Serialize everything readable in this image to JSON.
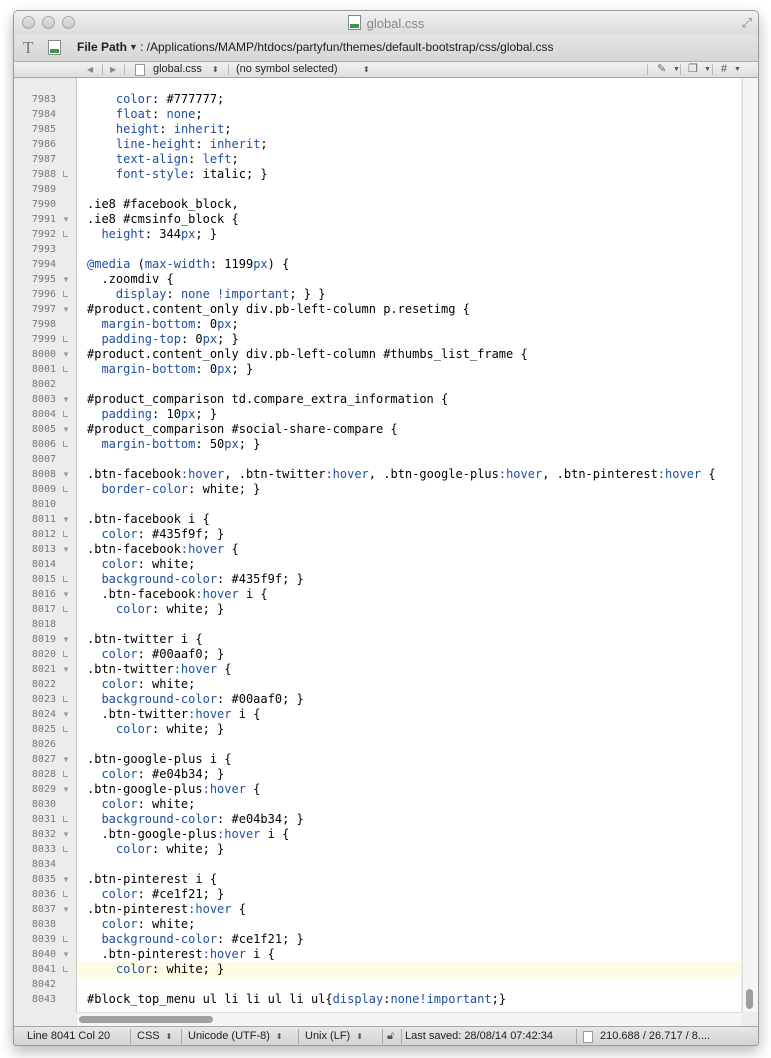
{
  "window": {
    "title": "global.css",
    "file_path_label": "File Path",
    "file_path": ": /Applications/MAMP/htdocs/partyfun/themes/default-bootstrap/css/global.css"
  },
  "navbar": {
    "back": "◀",
    "forward": "▶",
    "file_name": "global.css",
    "symbol": "(no symbol selected)",
    "hash": "#"
  },
  "code_lines": [
    {
      "n": "7983",
      "fold": "",
      "code": [
        [
          "    ",
          ""
        ],
        [
          "color",
          ".prop"
        ],
        [
          ": #777777;",
          ""
        ]
      ]
    },
    {
      "n": "7984",
      "fold": "",
      "code": [
        [
          "    ",
          ""
        ],
        [
          "float",
          ".prop"
        ],
        [
          ": ",
          ""
        ],
        [
          "none",
          "num"
        ],
        [
          ";",
          ""
        ]
      ]
    },
    {
      "n": "7985",
      "fold": "",
      "code": [
        [
          "    ",
          ""
        ],
        [
          "height",
          ".prop"
        ],
        [
          ": ",
          ""
        ],
        [
          "inherit",
          "num"
        ],
        [
          ";",
          ""
        ]
      ]
    },
    {
      "n": "7986",
      "fold": "",
      "code": [
        [
          "    ",
          ""
        ],
        [
          "line-height",
          ".prop"
        ],
        [
          ": ",
          ""
        ],
        [
          "inherit",
          "num"
        ],
        [
          ";",
          ""
        ]
      ]
    },
    {
      "n": "7987",
      "fold": "",
      "code": [
        [
          "    ",
          ""
        ],
        [
          "text-align",
          ".prop"
        ],
        [
          ": ",
          ""
        ],
        [
          "left",
          "num"
        ],
        [
          ";",
          ""
        ]
      ]
    },
    {
      "n": "7988",
      "fold": "end",
      "code": [
        [
          "    ",
          ""
        ],
        [
          "font-style",
          ".prop"
        ],
        [
          ": italic; }",
          ""
        ]
      ]
    },
    {
      "n": "7989",
      "fold": "",
      "code": []
    },
    {
      "n": "7990",
      "fold": "",
      "code": [
        [
          ".ie8 #facebook_block,",
          ""
        ]
      ]
    },
    {
      "n": "7991",
      "fold": "open",
      "code": [
        [
          ".ie8 #cmsinfo_block {",
          ""
        ]
      ]
    },
    {
      "n": "7992",
      "fold": "end",
      "code": [
        [
          "  ",
          ""
        ],
        [
          "height",
          ".prop"
        ],
        [
          ": 344",
          ""
        ],
        [
          "px",
          "num"
        ],
        [
          "; }",
          ""
        ]
      ]
    },
    {
      "n": "7993",
      "fold": "",
      "code": []
    },
    {
      "n": "7994",
      "fold": "",
      "code": [
        [
          "@media",
          "at"
        ],
        [
          " (",
          ""
        ],
        [
          "max-width",
          ".prop"
        ],
        [
          ": 1199",
          ""
        ],
        [
          "px",
          "num"
        ],
        [
          ") {",
          ""
        ]
      ]
    },
    {
      "n": "7995",
      "fold": "open",
      "code": [
        [
          "  .zoomdiv {",
          ""
        ]
      ]
    },
    {
      "n": "7996",
      "fold": "end",
      "code": [
        [
          "    ",
          ""
        ],
        [
          "display",
          ".prop"
        ],
        [
          ": ",
          ""
        ],
        [
          "none !important",
          "num"
        ],
        [
          "; } }",
          ""
        ]
      ]
    },
    {
      "n": "7997",
      "fold": "open",
      "code": [
        [
          "#product.content_only div.pb-left-column p.resetimg {",
          ""
        ]
      ]
    },
    {
      "n": "7998",
      "fold": "",
      "code": [
        [
          "  ",
          ""
        ],
        [
          "margin-bottom",
          ".prop"
        ],
        [
          ": 0",
          ""
        ],
        [
          "px",
          "num"
        ],
        [
          ";",
          ""
        ]
      ]
    },
    {
      "n": "7999",
      "fold": "end",
      "code": [
        [
          "  ",
          ""
        ],
        [
          "padding-top",
          ".prop"
        ],
        [
          ": 0",
          ""
        ],
        [
          "px",
          "num"
        ],
        [
          "; }",
          ""
        ]
      ]
    },
    {
      "n": "8000",
      "fold": "open",
      "code": [
        [
          "#product.content_only div.pb-left-column #thumbs_list_frame {",
          ""
        ]
      ]
    },
    {
      "n": "8001",
      "fold": "end",
      "code": [
        [
          "  ",
          ""
        ],
        [
          "margin-bottom",
          ".prop"
        ],
        [
          ": 0",
          ""
        ],
        [
          "px",
          "num"
        ],
        [
          "; }",
          ""
        ]
      ]
    },
    {
      "n": "8002",
      "fold": "",
      "code": []
    },
    {
      "n": "8003",
      "fold": "open",
      "code": [
        [
          "#product_comparison td.compare_extra_information {",
          ""
        ]
      ]
    },
    {
      "n": "8004",
      "fold": "end",
      "code": [
        [
          "  ",
          ""
        ],
        [
          "padding",
          ".prop"
        ],
        [
          ": 10",
          ""
        ],
        [
          "px",
          "num"
        ],
        [
          "; }",
          ""
        ]
      ]
    },
    {
      "n": "8005",
      "fold": "open",
      "code": [
        [
          "#product_comparison #social-share-compare {",
          ""
        ]
      ]
    },
    {
      "n": "8006",
      "fold": "end",
      "code": [
        [
          "  ",
          ""
        ],
        [
          "margin-bottom",
          ".prop"
        ],
        [
          ": 50",
          ""
        ],
        [
          "px",
          "num"
        ],
        [
          "; }",
          ""
        ]
      ]
    },
    {
      "n": "8007",
      "fold": "",
      "code": []
    },
    {
      "n": "8008",
      "fold": "open",
      "code": [
        [
          ".btn-facebook",
          ""
        ],
        [
          ":hover",
          "num"
        ],
        [
          ", .btn-twitter",
          ""
        ],
        [
          ":hover",
          "num"
        ],
        [
          ", .btn-google-plus",
          ""
        ],
        [
          ":hover",
          "num"
        ],
        [
          ", .btn-pinterest",
          ""
        ],
        [
          ":hover",
          "num"
        ],
        [
          " {",
          ""
        ]
      ]
    },
    {
      "n": "8009",
      "fold": "end",
      "code": [
        [
          "  ",
          ""
        ],
        [
          "border-color",
          ".prop"
        ],
        [
          ": white; }",
          ""
        ]
      ]
    },
    {
      "n": "8010",
      "fold": "",
      "code": []
    },
    {
      "n": "8011",
      "fold": "open",
      "code": [
        [
          ".btn-facebook i {",
          ""
        ]
      ]
    },
    {
      "n": "8012",
      "fold": "end",
      "code": [
        [
          "  ",
          ""
        ],
        [
          "color",
          ".prop"
        ],
        [
          ": #435f9f; }",
          ""
        ]
      ]
    },
    {
      "n": "8013",
      "fold": "open",
      "code": [
        [
          ".btn-facebook",
          ""
        ],
        [
          ":hover",
          "num"
        ],
        [
          " {",
          ""
        ]
      ]
    },
    {
      "n": "8014",
      "fold": "",
      "code": [
        [
          "  ",
          ""
        ],
        [
          "color",
          ".prop"
        ],
        [
          ": white;",
          ""
        ]
      ]
    },
    {
      "n": "8015",
      "fold": "end",
      "code": [
        [
          "  ",
          ""
        ],
        [
          "background-color",
          ".prop"
        ],
        [
          ": #435f9f; }",
          ""
        ]
      ]
    },
    {
      "n": "8016",
      "fold": "open",
      "code": [
        [
          "  .btn-facebook",
          ""
        ],
        [
          ":hover",
          "num"
        ],
        [
          " i {",
          ""
        ]
      ]
    },
    {
      "n": "8017",
      "fold": "end",
      "code": [
        [
          "    ",
          ""
        ],
        [
          "color",
          ".prop"
        ],
        [
          ": white; }",
          ""
        ]
      ]
    },
    {
      "n": "8018",
      "fold": "",
      "code": []
    },
    {
      "n": "8019",
      "fold": "open",
      "code": [
        [
          ".btn-twitter i {",
          ""
        ]
      ]
    },
    {
      "n": "8020",
      "fold": "end",
      "code": [
        [
          "  ",
          ""
        ],
        [
          "color",
          ".prop"
        ],
        [
          ": #00aaf0; }",
          ""
        ]
      ]
    },
    {
      "n": "8021",
      "fold": "open",
      "code": [
        [
          ".btn-twitter",
          ""
        ],
        [
          ":hover",
          "num"
        ],
        [
          " {",
          ""
        ]
      ]
    },
    {
      "n": "8022",
      "fold": "",
      "code": [
        [
          "  ",
          ""
        ],
        [
          "color",
          ".prop"
        ],
        [
          ": white;",
          ""
        ]
      ]
    },
    {
      "n": "8023",
      "fold": "end",
      "code": [
        [
          "  ",
          ""
        ],
        [
          "background-color",
          ".prop"
        ],
        [
          ": #00aaf0; }",
          ""
        ]
      ]
    },
    {
      "n": "8024",
      "fold": "open",
      "code": [
        [
          "  .btn-twitter",
          ""
        ],
        [
          ":hover",
          "num"
        ],
        [
          " i {",
          ""
        ]
      ]
    },
    {
      "n": "8025",
      "fold": "end",
      "code": [
        [
          "    ",
          ""
        ],
        [
          "color",
          ".prop"
        ],
        [
          ": white; }",
          ""
        ]
      ]
    },
    {
      "n": "8026",
      "fold": "",
      "code": []
    },
    {
      "n": "8027",
      "fold": "open",
      "code": [
        [
          ".btn-google-plus i {",
          ""
        ]
      ]
    },
    {
      "n": "8028",
      "fold": "end",
      "code": [
        [
          "  ",
          ""
        ],
        [
          "color",
          ".prop"
        ],
        [
          ": #e04b34; }",
          ""
        ]
      ]
    },
    {
      "n": "8029",
      "fold": "open",
      "code": [
        [
          ".btn-google-plus",
          ""
        ],
        [
          ":hover",
          "num"
        ],
        [
          " {",
          ""
        ]
      ]
    },
    {
      "n": "8030",
      "fold": "",
      "code": [
        [
          "  ",
          ""
        ],
        [
          "color",
          ".prop"
        ],
        [
          ": white;",
          ""
        ]
      ]
    },
    {
      "n": "8031",
      "fold": "end",
      "code": [
        [
          "  ",
          ""
        ],
        [
          "background-color",
          ".prop"
        ],
        [
          ": #e04b34; }",
          ""
        ]
      ]
    },
    {
      "n": "8032",
      "fold": "open",
      "code": [
        [
          "  .btn-google-plus",
          ""
        ],
        [
          ":hover",
          "num"
        ],
        [
          " i {",
          ""
        ]
      ]
    },
    {
      "n": "8033",
      "fold": "end",
      "code": [
        [
          "    ",
          ""
        ],
        [
          "color",
          ".prop"
        ],
        [
          ": white; }",
          ""
        ]
      ]
    },
    {
      "n": "8034",
      "fold": "",
      "code": []
    },
    {
      "n": "8035",
      "fold": "open",
      "code": [
        [
          ".btn-pinterest i {",
          ""
        ]
      ]
    },
    {
      "n": "8036",
      "fold": "end",
      "code": [
        [
          "  ",
          ""
        ],
        [
          "color",
          ".prop"
        ],
        [
          ": #ce1f21; }",
          ""
        ]
      ]
    },
    {
      "n": "8037",
      "fold": "open",
      "code": [
        [
          ".btn-pinterest",
          ""
        ],
        [
          ":hover",
          "num"
        ],
        [
          " {",
          ""
        ]
      ]
    },
    {
      "n": "8038",
      "fold": "",
      "code": [
        [
          "  ",
          ""
        ],
        [
          "color",
          ".prop"
        ],
        [
          ": white;",
          ""
        ]
      ]
    },
    {
      "n": "8039",
      "fold": "end",
      "code": [
        [
          "  ",
          ""
        ],
        [
          "background-color",
          ".prop"
        ],
        [
          ": #ce1f21; }",
          ""
        ]
      ]
    },
    {
      "n": "8040",
      "fold": "open",
      "code": [
        [
          "  .btn-pinterest",
          ""
        ],
        [
          ":hover",
          "num"
        ],
        [
          " i {",
          ""
        ]
      ]
    },
    {
      "n": "8041",
      "fold": "end",
      "code": [
        [
          "    ",
          ""
        ],
        [
          "color",
          ".prop"
        ],
        [
          ": white; }",
          ""
        ]
      ]
    },
    {
      "n": "8042",
      "fold": "",
      "code": []
    },
    {
      "n": "8043",
      "fold": "",
      "code": [
        [
          "#block_top_menu ul li li ul li ul{",
          ""
        ],
        [
          "display",
          ".prop"
        ],
        [
          ":",
          ""
        ],
        [
          "none!important",
          "num"
        ],
        [
          ";}",
          ""
        ]
      ]
    }
  ],
  "current_line_number": "8041",
  "status": {
    "position": "Line 8041 Col 20",
    "syntax": "CSS",
    "encoding": "Unicode (UTF-8)",
    "line_endings": "Unix (LF)",
    "saved": "Last saved: 28/08/14 07:42:34",
    "size": "210.688 / 26.717 / 8...."
  },
  "colors": {
    "property": "#1e50a0",
    "current_line_bg": "#fefbe4"
  }
}
